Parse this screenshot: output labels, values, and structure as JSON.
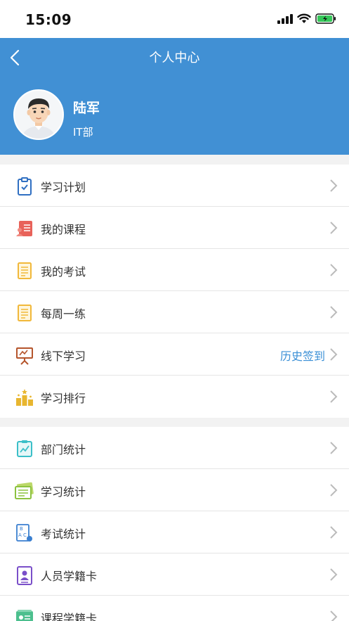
{
  "status_bar": {
    "time": "15:09"
  },
  "header": {
    "title": "个人中心",
    "user_name": "陆军",
    "department": "IT部"
  },
  "menu_group_1": [
    {
      "label": "学习计划",
      "icon": "clipboard-check-icon"
    },
    {
      "label": "我的课程",
      "icon": "course-icon"
    },
    {
      "label": "我的考试",
      "icon": "exam-doc-icon"
    },
    {
      "label": "每周一练",
      "icon": "practice-doc-icon"
    },
    {
      "label": "线下学习",
      "icon": "easel-icon",
      "extra": "历史签到"
    },
    {
      "label": "学习排行",
      "icon": "podium-icon"
    }
  ],
  "menu_group_2": [
    {
      "label": "部门统计",
      "icon": "chart-icon"
    },
    {
      "label": "学习统计",
      "icon": "stats-card-icon"
    },
    {
      "label": "考试统计",
      "icon": "abc-icon"
    },
    {
      "label": "人员学籍卡",
      "icon": "person-card-icon"
    },
    {
      "label": "课程学籍卡",
      "icon": "course-card-icon"
    }
  ],
  "colors": {
    "header_bg": "#4190d4",
    "accent_link": "#3a8fd6"
  }
}
